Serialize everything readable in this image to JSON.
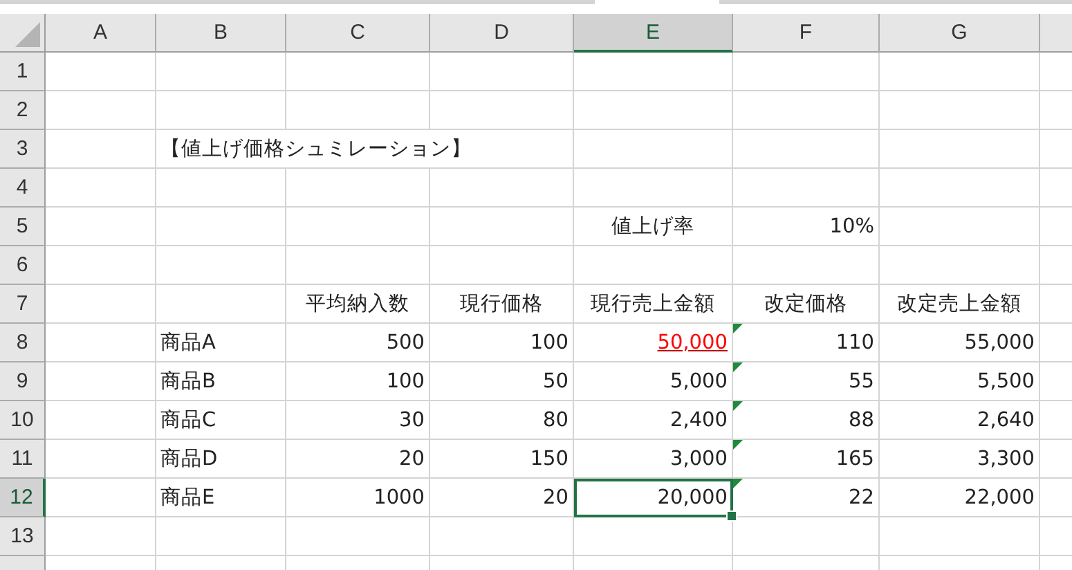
{
  "columns": [
    {
      "label": "A",
      "selected": false
    },
    {
      "label": "B",
      "selected": false
    },
    {
      "label": "C",
      "selected": false
    },
    {
      "label": "D",
      "selected": false
    },
    {
      "label": "E",
      "selected": true
    },
    {
      "label": "F",
      "selected": false
    },
    {
      "label": "G",
      "selected": false
    }
  ],
  "rows": [
    {
      "label": "1",
      "selected": false,
      "cells": [
        null,
        null,
        null,
        null,
        null,
        null,
        null
      ]
    },
    {
      "label": "2",
      "selected": false,
      "cells": [
        null,
        null,
        null,
        null,
        null,
        null,
        null
      ]
    },
    {
      "label": "3",
      "selected": false,
      "cells": [
        null,
        {
          "text": "【値上げ価格シュミレーション】",
          "kind": "label",
          "flagged": false,
          "selected": false
        },
        null,
        null,
        null,
        null,
        null
      ]
    },
    {
      "label": "4",
      "selected": false,
      "cells": [
        null,
        null,
        null,
        null,
        null,
        null,
        null
      ]
    },
    {
      "label": "5",
      "selected": false,
      "cells": [
        null,
        null,
        null,
        null,
        {
          "text": "値上げ率",
          "kind": "heading",
          "flagged": false,
          "selected": false
        },
        {
          "text": "10%",
          "kind": "number",
          "flagged": false,
          "selected": false
        },
        null
      ]
    },
    {
      "label": "6",
      "selected": false,
      "cells": [
        null,
        null,
        null,
        null,
        null,
        null,
        null
      ]
    },
    {
      "label": "7",
      "selected": false,
      "cells": [
        null,
        null,
        {
          "text": "平均納入数",
          "kind": "heading",
          "flagged": false,
          "selected": false
        },
        {
          "text": "現行価格",
          "kind": "heading",
          "flagged": false,
          "selected": false
        },
        {
          "text": "現行売上金額",
          "kind": "heading",
          "flagged": false,
          "selected": false
        },
        {
          "text": "改定価格",
          "kind": "heading",
          "flagged": false,
          "selected": false
        },
        {
          "text": "改定売上金額",
          "kind": "heading",
          "flagged": false,
          "selected": false
        }
      ]
    },
    {
      "label": "8",
      "selected": false,
      "cells": [
        null,
        {
          "text": "商品A",
          "kind": "label",
          "flagged": false,
          "selected": false
        },
        {
          "text": "500",
          "kind": "number",
          "flagged": false,
          "selected": false
        },
        {
          "text": "100",
          "kind": "number",
          "flagged": false,
          "selected": false
        },
        {
          "text": "50,000",
          "kind": "alert",
          "flagged": false,
          "selected": false
        },
        {
          "text": "110",
          "kind": "number",
          "flagged": true,
          "selected": false
        },
        {
          "text": "55,000",
          "kind": "number",
          "flagged": false,
          "selected": false
        }
      ]
    },
    {
      "label": "9",
      "selected": false,
      "cells": [
        null,
        {
          "text": "商品B",
          "kind": "label",
          "flagged": false,
          "selected": false
        },
        {
          "text": "100",
          "kind": "number",
          "flagged": false,
          "selected": false
        },
        {
          "text": "50",
          "kind": "number",
          "flagged": false,
          "selected": false
        },
        {
          "text": "5,000",
          "kind": "number",
          "flagged": false,
          "selected": false
        },
        {
          "text": "55",
          "kind": "number",
          "flagged": true,
          "selected": false
        },
        {
          "text": "5,500",
          "kind": "number",
          "flagged": false,
          "selected": false
        }
      ]
    },
    {
      "label": "10",
      "selected": false,
      "cells": [
        null,
        {
          "text": "商品C",
          "kind": "label",
          "flagged": false,
          "selected": false
        },
        {
          "text": "30",
          "kind": "number",
          "flagged": false,
          "selected": false
        },
        {
          "text": "80",
          "kind": "number",
          "flagged": false,
          "selected": false
        },
        {
          "text": "2,400",
          "kind": "number",
          "flagged": false,
          "selected": false
        },
        {
          "text": "88",
          "kind": "number",
          "flagged": true,
          "selected": false
        },
        {
          "text": "2,640",
          "kind": "number",
          "flagged": false,
          "selected": false
        }
      ]
    },
    {
      "label": "11",
      "selected": false,
      "cells": [
        null,
        {
          "text": "商品D",
          "kind": "label",
          "flagged": false,
          "selected": false
        },
        {
          "text": "20",
          "kind": "number",
          "flagged": false,
          "selected": false
        },
        {
          "text": "150",
          "kind": "number",
          "flagged": false,
          "selected": false
        },
        {
          "text": "3,000",
          "kind": "number",
          "flagged": false,
          "selected": false
        },
        {
          "text": "165",
          "kind": "number",
          "flagged": true,
          "selected": false
        },
        {
          "text": "3,300",
          "kind": "number",
          "flagged": false,
          "selected": false
        }
      ]
    },
    {
      "label": "12",
      "selected": true,
      "cells": [
        null,
        {
          "text": "商品E",
          "kind": "label",
          "flagged": false,
          "selected": false
        },
        {
          "text": "1000",
          "kind": "number",
          "flagged": false,
          "selected": false
        },
        {
          "text": "20",
          "kind": "number",
          "flagged": false,
          "selected": false
        },
        {
          "text": "20,000",
          "kind": "number",
          "flagged": false,
          "selected": true
        },
        {
          "text": "22",
          "kind": "number",
          "flagged": true,
          "selected": false
        },
        {
          "text": "22,000",
          "kind": "number",
          "flagged": false,
          "selected": false
        }
      ]
    },
    {
      "label": "13",
      "selected": false,
      "cells": [
        null,
        null,
        null,
        null,
        null,
        null,
        null
      ]
    }
  ]
}
